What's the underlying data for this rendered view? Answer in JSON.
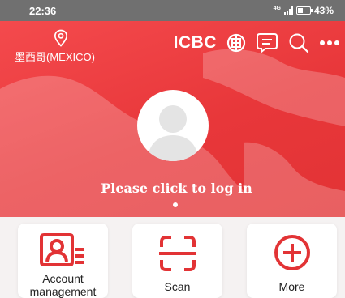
{
  "status_bar": {
    "time": "22:36",
    "battery": "43%",
    "network": "4G"
  },
  "header": {
    "location_label": "墨西哥(MEXICO)",
    "location_icon": "location-pin-icon",
    "brand": "ICBC",
    "icons": [
      "icbc-logo-icon",
      "message-icon",
      "search-icon",
      "more-icon"
    ]
  },
  "profile": {
    "avatar_icon": "user-avatar-icon",
    "login_prompt": "Please click to log in"
  },
  "quick_actions": [
    {
      "label": "Account management",
      "icon": "account-management-icon"
    },
    {
      "label": "Scan",
      "icon": "scan-icon"
    },
    {
      "label": "More",
      "icon": "plus-circle-icon"
    }
  ],
  "colors": {
    "brand_red": "#e8373a",
    "status_bar": "#707070"
  }
}
